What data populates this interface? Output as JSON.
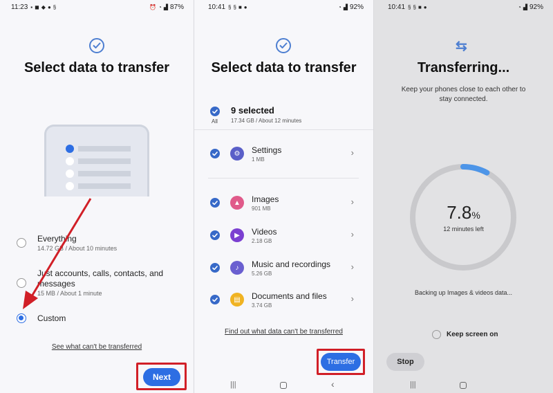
{
  "panel1": {
    "status": {
      "time": "11:23",
      "icons_left": [
        "message-icon",
        "facebook-icon",
        "bell-icon",
        "dot-icon",
        "s-icon",
        "bell-icon"
      ],
      "battery": "87%"
    },
    "title": "Select data to transfer",
    "options": [
      {
        "label": "Everything",
        "sub": "14.72 GB / About 10 minutes",
        "selected": false
      },
      {
        "label": "Just accounts, calls, contacts, and",
        "label2": "messages",
        "sub": "15 MB / About 1 minute",
        "selected": false
      },
      {
        "label": "Custom",
        "sub": "",
        "selected": true
      }
    ],
    "link": "See what can't be transferred",
    "next_button": "Next"
  },
  "panel2": {
    "status": {
      "time": "10:41",
      "battery": "92%"
    },
    "title": "Select data to transfer",
    "all_label": "All",
    "selected_count": "9 selected",
    "selected_meta": "17.34 GB / About 12 minutes",
    "items": [
      {
        "name": "Settings",
        "size": "1 MB",
        "icon": "gear-icon",
        "color": "#5a5fc8"
      },
      {
        "name": "Images",
        "size": "901 MB",
        "icon": "image-icon",
        "color": "#e05a8a"
      },
      {
        "name": "Videos",
        "size": "2.18 GB",
        "icon": "play-icon",
        "color": "#7b3fd1"
      },
      {
        "name": "Music and recordings",
        "size": "5.26 GB",
        "icon": "music-icon",
        "color": "#6a5fd0"
      },
      {
        "name": "Documents and files",
        "size": "3.74 GB",
        "icon": "document-icon",
        "color": "#f0b322"
      }
    ],
    "link": "Find out what data can't be transferred",
    "transfer_button": "Transfer"
  },
  "panel3": {
    "status": {
      "time": "10:41",
      "battery": "92%"
    },
    "title": "Transferring...",
    "subtitle_line1": "Keep your phones close to each other to",
    "subtitle_line2": "stay connected.",
    "percent": "7.8",
    "percent_sign": "%",
    "progress_fraction": 0.078,
    "time_left": "12 minutes left",
    "backup_status": "Backing up Images & videos data...",
    "keep_screen_on": "Keep screen on",
    "stop_button": "Stop"
  },
  "colors": {
    "accent": "#2d6ee3",
    "highlight": "#d11f27"
  }
}
